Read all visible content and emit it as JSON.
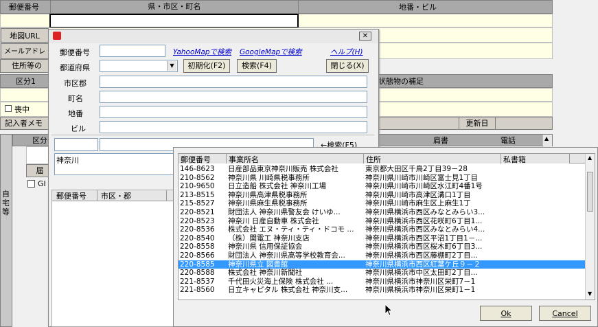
{
  "main": {
    "col_postal": "郵便番号",
    "col_pref_city": "県・市区・町名",
    "col_address": "地番・ビル",
    "map_url": "地図URL",
    "mail_address": "メールアドレス",
    "address_etc": "住所等の",
    "division": "区分1",
    "situation_confirm": "状態物の補足",
    "mourning": "喪中",
    "entry_person": "記入者メモ",
    "update_date": "更新日",
    "division_short": "区分",
    "title_col": "肩書",
    "phone_col": "電話",
    "home_tab": "自宅等",
    "gi_label": "GI",
    "side_label": "届"
  },
  "dialog": {
    "postal_label": "郵便番号",
    "pref_label": "都道府県",
    "city_label": "市区郡",
    "town_label": "町名",
    "lot_label": "地番",
    "building_label": "ビル",
    "yahoo_link": "YahooMapで検索",
    "google_link": "GoogleMapで検索",
    "help_link": "ヘルプ(H)",
    "init_button": "初期化(F2)",
    "search_button": "検索(F4)",
    "close_button": "閉じる(X)",
    "search_arrow": "←検索(F5)",
    "search_value": "神奈川",
    "result_col_postal": "郵便番号",
    "result_col_city": "市区・郡"
  },
  "results": {
    "columns": [
      "郵便番号",
      "事業所名",
      "住所",
      "私書箱"
    ],
    "rows": [
      [
        "146-8623",
        "日産部品東京神奈川販売 株式会社",
        "東京都大田区千鳥2丁目39－28",
        ""
      ],
      [
        "210-8562",
        "神奈川県 川崎県税事務所",
        "神奈川県川崎市川崎区富士見1丁目",
        ""
      ],
      [
        "210-9650",
        "日立造船 株式会社 神奈川工場",
        "神奈川県川崎市川崎区水江町4番1号",
        ""
      ],
      [
        "213-8515",
        "神奈川県高津県税事務所",
        "神奈川県川崎市高津区溝口1丁目",
        ""
      ],
      [
        "215-8527",
        "神奈川県麻生県税事務所",
        "神奈川県川崎市麻生区上麻生1丁",
        ""
      ],
      [
        "220-8521",
        "財団法人 神奈川県警友会 けいゆ...",
        "神奈川県横浜市西区みなとみらい3...",
        ""
      ],
      [
        "220-8523",
        "神奈川 日産自動車 株式会社",
        "神奈川県横浜市西区花咲町6丁目1...",
        ""
      ],
      [
        "220-8536",
        "株式会社 エヌ・ティ・ティ・ドコモ ...",
        "神奈川県横浜市西区みなとみらい4...",
        ""
      ],
      [
        "220-8540",
        "（株）関電工 神奈川支店",
        "神奈川県横浜市西区平沼1丁目1－...",
        ""
      ],
      [
        "220-8558",
        "神奈川県 信用保証協会",
        "神奈川県横浜市西区桜木町6丁目3...",
        ""
      ],
      [
        "220-8566",
        "財団法人 神奈川県高等学校教育会...",
        "神奈川県横浜市西区藤棚町2丁目...",
        ""
      ],
      [
        "220-8585",
        "神奈川県立 図書館",
        "神奈川県横浜市西区紅葉ケ丘９－２",
        ""
      ],
      [
        "220-8588",
        "株式会社 神奈川新聞社",
        "神奈川県横浜市中区太田町2丁目...",
        ""
      ],
      [
        "221-8537",
        "千代田火災海上保険 株式会社 ...",
        "神奈川県横浜市神奈川区栄町7－1",
        ""
      ],
      [
        "221-8560",
        "日立キャピタル 株式会社 神奈川支...",
        "神奈川県横浜市神奈川区栄町1－1",
        ""
      ]
    ],
    "selected_index": 11,
    "ok_button": "Ok",
    "cancel_button": "Cancel"
  }
}
